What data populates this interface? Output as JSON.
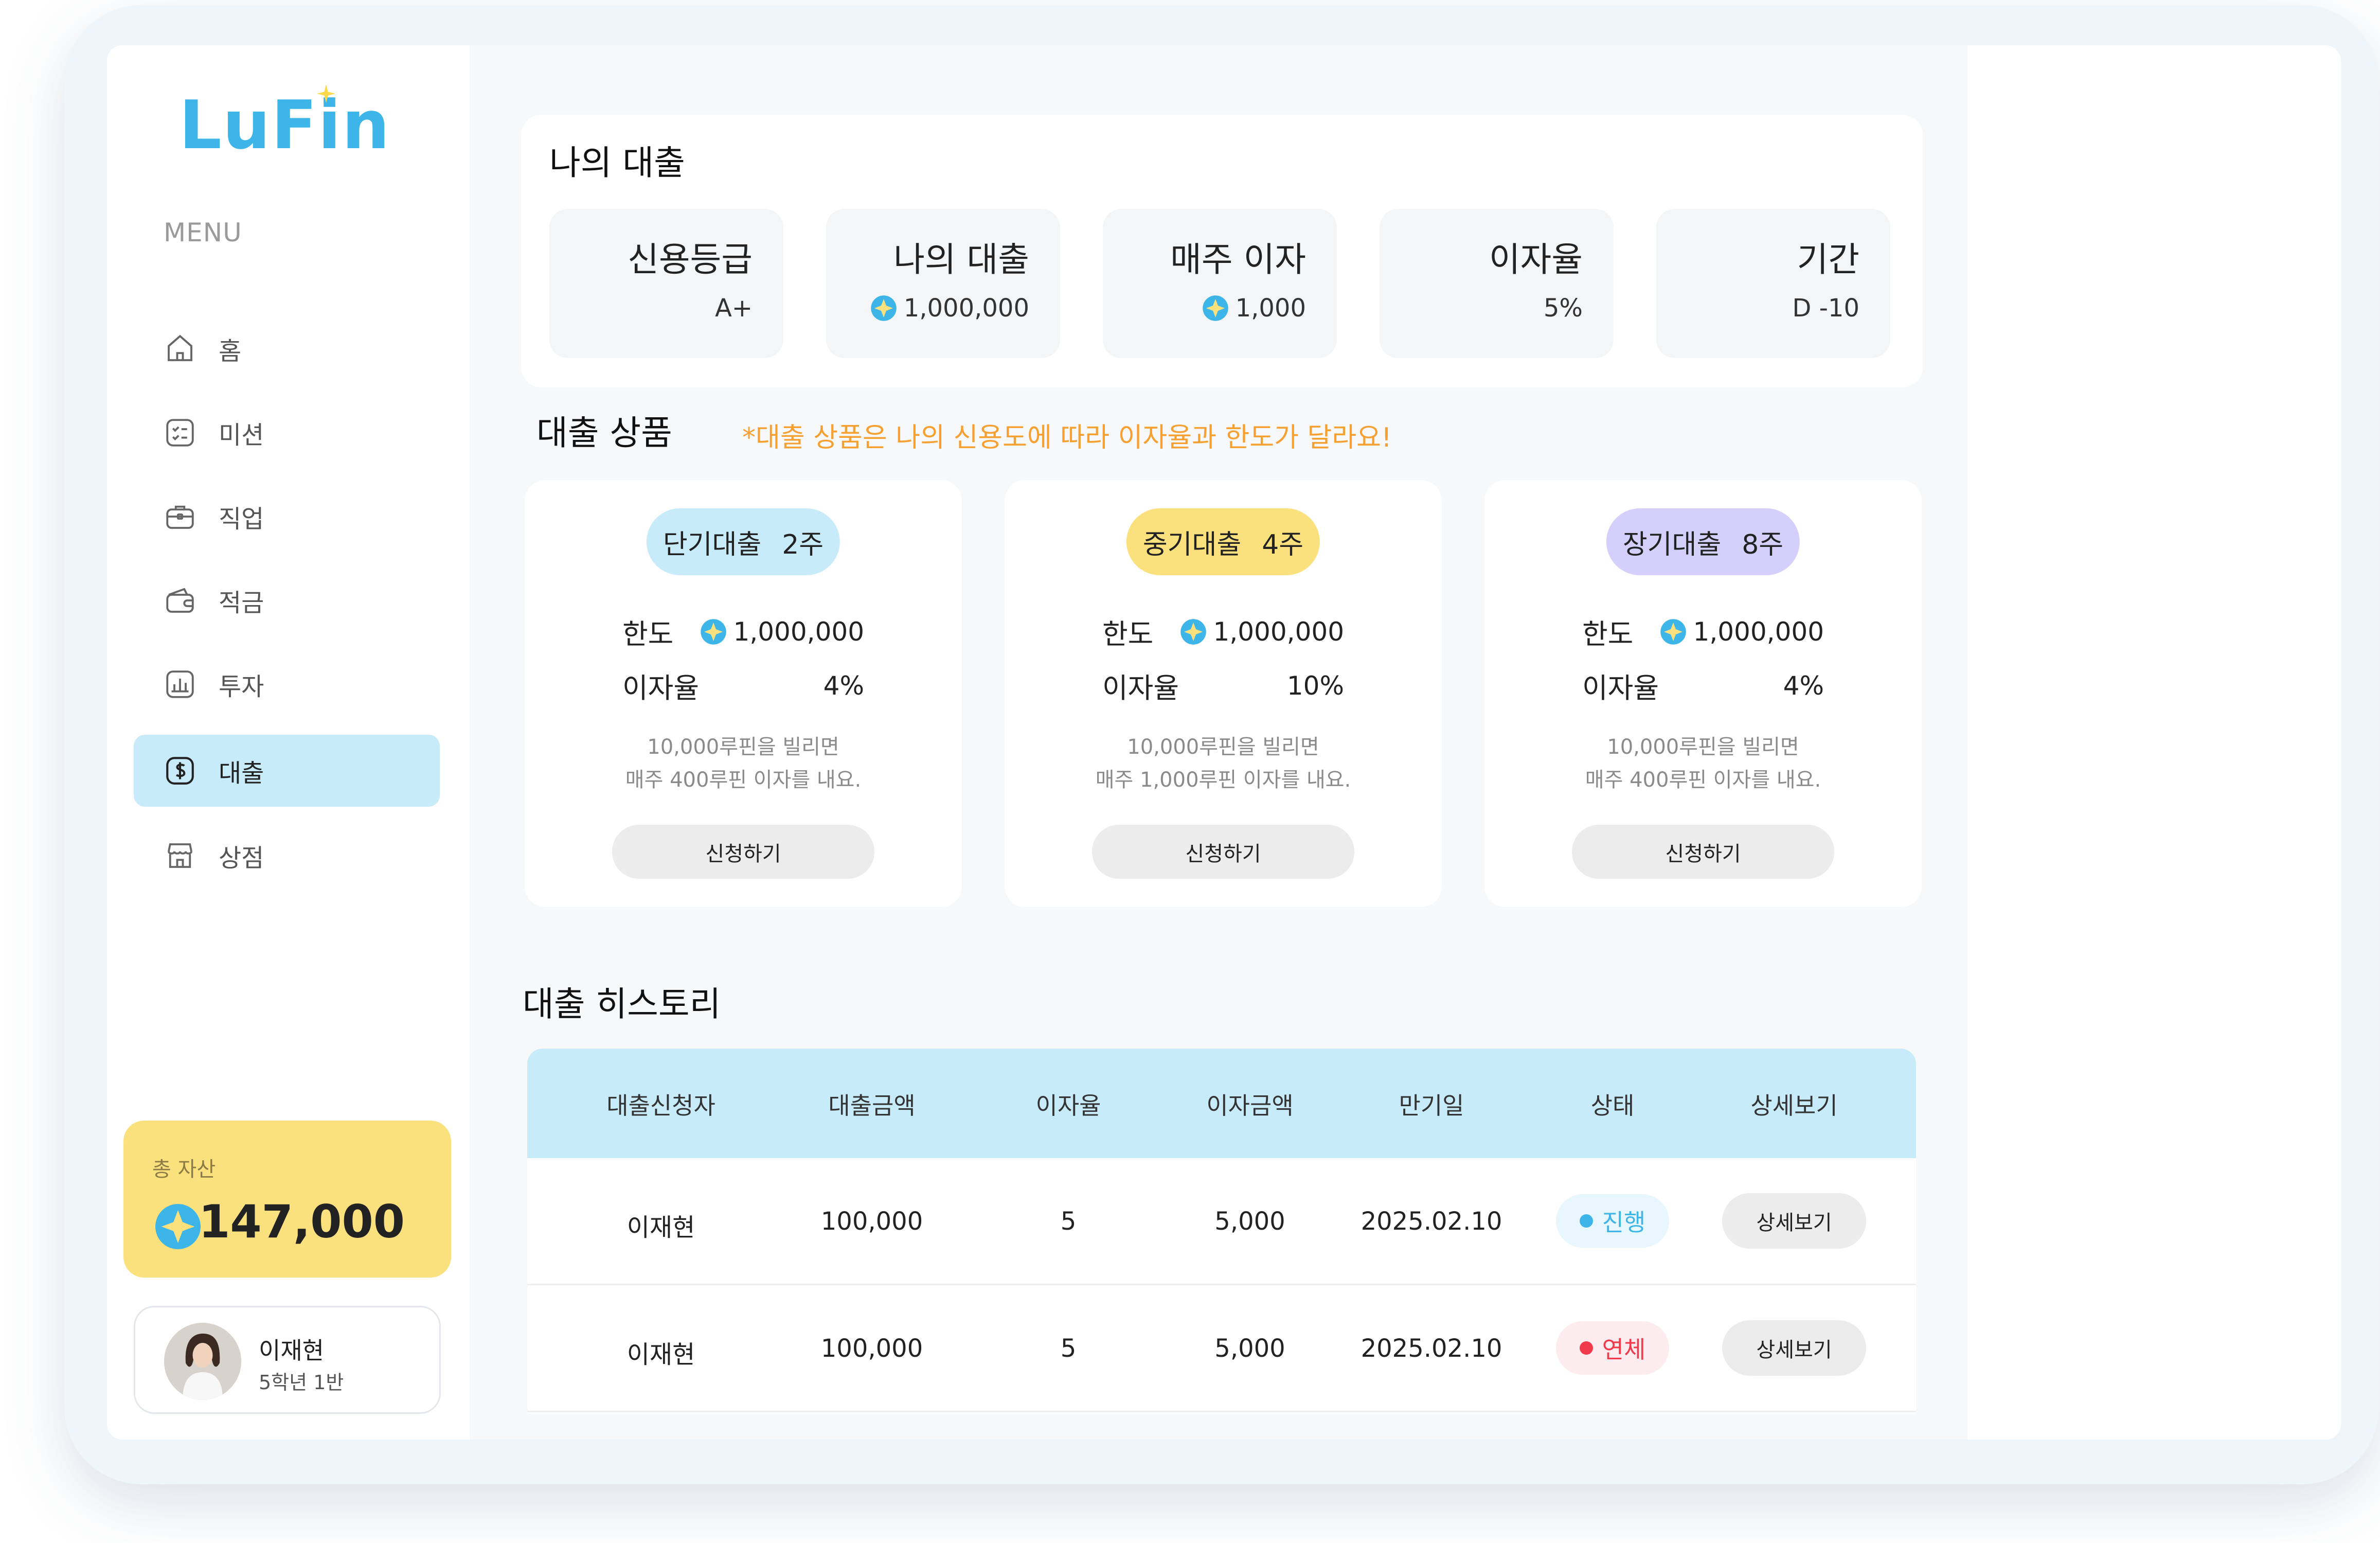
{
  "app": {
    "logo_text": "LuFin"
  },
  "sidebar": {
    "menu_title": "MENU",
    "items": [
      {
        "label": "홈",
        "icon": "home-icon"
      },
      {
        "label": "미션",
        "icon": "checklist-icon"
      },
      {
        "label": "직업",
        "icon": "briefcase-icon"
      },
      {
        "label": "적금",
        "icon": "wallet-icon"
      },
      {
        "label": "투자",
        "icon": "chart-icon"
      },
      {
        "label": "대출",
        "icon": "dollar-icon",
        "active": true
      },
      {
        "label": "상점",
        "icon": "store-icon"
      }
    ],
    "asset": {
      "title": "총 자산",
      "value": "147,000"
    },
    "profile": {
      "name": "이재현",
      "class": "5학년 1반"
    }
  },
  "my_loan": {
    "title": "나의 대출",
    "stats": [
      {
        "label": "신용등급",
        "value": "A+",
        "coin": false
      },
      {
        "label": "나의 대출",
        "value": "1,000,000",
        "coin": true
      },
      {
        "label": "매주 이자",
        "value": "1,000",
        "coin": true
      },
      {
        "label": "이자율",
        "value": "5%",
        "coin": false
      },
      {
        "label": "기간",
        "value": "D -10",
        "coin": false
      }
    ]
  },
  "products": {
    "title": "대출 상품",
    "note": "*대출 상품은 나의 신용도에 따라 이자율과 한도가 달라요!",
    "limit_label": "한도",
    "rate_label": "이자율",
    "apply_label": "신청하기",
    "items": [
      {
        "name": "단기대출",
        "weeks": "2주",
        "color": "#c8ebfa",
        "limit": "1,000,000",
        "rate": "4%",
        "desc1": "10,000루핀을 빌리면",
        "desc2": "매주 400루핀 이자를 내요."
      },
      {
        "name": "중기대출",
        "weeks": "4주",
        "color": "#fbe17d",
        "limit": "1,000,000",
        "rate": "10%",
        "desc1": "10,000루핀을 빌리면",
        "desc2": "매주 1,000루핀 이자를 내요."
      },
      {
        "name": "장기대출",
        "weeks": "8주",
        "color": "#d4d0fb",
        "limit": "1,000,000",
        "rate": "4%",
        "desc1": "10,000루핀을 빌리면",
        "desc2": "매주 400루핀 이자를 내요."
      }
    ]
  },
  "history": {
    "title": "대출 히스토리",
    "columns": [
      "대출신청자",
      "대출금액",
      "이자율",
      "이자금액",
      "만기일",
      "상태",
      "상세보기"
    ],
    "rows": [
      {
        "applicant": "이재현",
        "amount": "100,000",
        "rate": "5",
        "interest": "5,000",
        "due": "2025.02.10",
        "status": "진행",
        "status_color": "#3db5e8",
        "status_bg": "#e8f6fd",
        "detail": "상세보기"
      },
      {
        "applicant": "이재현",
        "amount": "100,000",
        "rate": "5",
        "interest": "5,000",
        "due": "2025.02.10",
        "status": "연체",
        "status_color": "#f0394a",
        "status_bg": "#fdecef",
        "detail": "상세보기"
      }
    ]
  }
}
